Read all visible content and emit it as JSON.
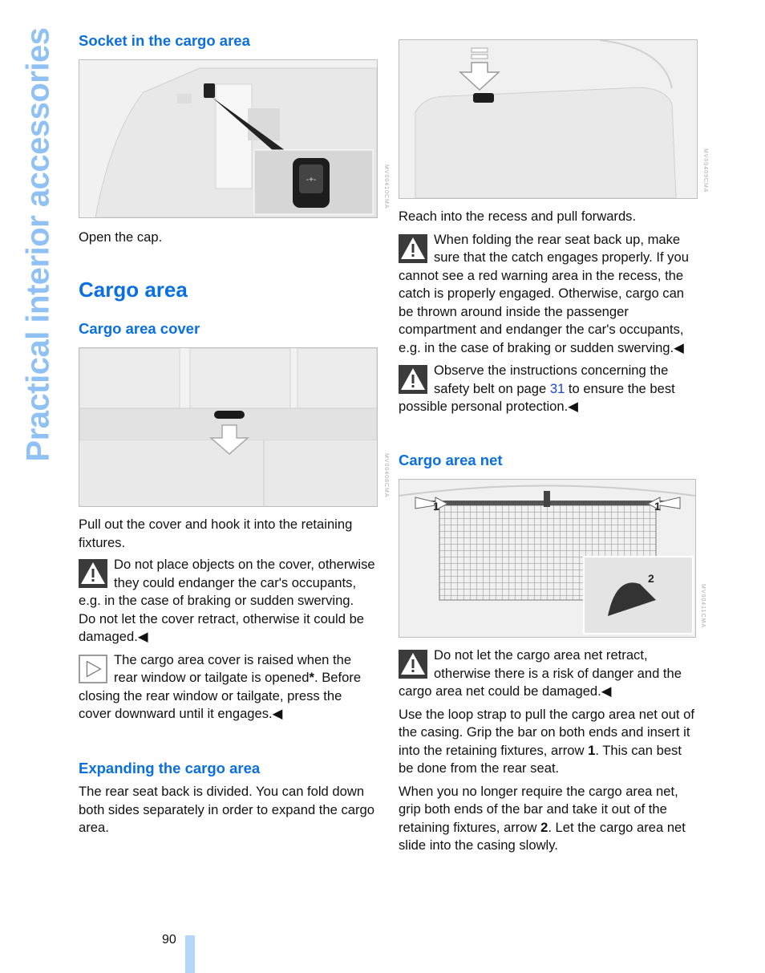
{
  "section_title": "Practical interior accessories",
  "page_number": "90",
  "left": {
    "socket_heading": "Socket in the cargo area",
    "socket_figure_code": "MV00410CMA",
    "socket_text": "Open the cap.",
    "cargo_heading": "Cargo area",
    "cover_heading": "Cargo area cover",
    "cover_figure_code": "MV00408CMA",
    "cover_text": "Pull out the cover and hook it into the retaining fixtures.",
    "warning1_text": "Do not place objects on the cover, otherwise they could endanger the car's occupants, e.g. in the case of braking or sudden swerving.",
    "warning1_text2": "Do not let the cover retract, otherwise it could be damaged.",
    "end_mark": "◀",
    "hint_text_a": "The cargo area cover is raised when the rear window or tailgate is opened",
    "hint_asterisk": "*",
    "hint_text_b": ". Before closing the rear window or tailgate, press the cover downward until it engages.",
    "expand_heading": "Expanding the cargo area",
    "expand_text": "The rear seat back is divided. You can fold down both sides separately in order to expand the cargo area."
  },
  "right": {
    "seat_figure_code": "MV00409CMA",
    "seat_text": "Reach into the recess and pull forwards.",
    "warning2_text": "When folding the rear seat back up, make sure that the catch engages properly. If you cannot see a red warning area in the recess, the catch is properly engaged. Otherwise, cargo can be thrown around inside the passenger compartment and endanger the car's occupants, e.g. in the case of braking or sudden swerving.",
    "warning3_text_a": "Observe the instructions concerning the safety belt on page ",
    "warning3_link": "31",
    "warning3_text_b": " to ensure the best possible personal protection.",
    "net_heading": "Cargo area net",
    "net_figure_code": "MV00411CMA",
    "net_label_1": "1",
    "net_label_2": "2",
    "warning4_text": "Do not let the cargo area net retract, otherwise there is a risk of danger and the cargo area net could be damaged.",
    "net_text1_a": "Use the loop strap to pull the cargo area net out of the casing. Grip the bar on both ends and insert it into the retaining fixtures, arrow ",
    "net_text1_bold": "1",
    "net_text1_b": ". This can best be done from the rear seat.",
    "net_text2_a": "When you no longer require the cargo area net, grip both ends of the bar and take it out of the retaining fixtures, arrow ",
    "net_text2_bold": "2",
    "net_text2_b": ". Let the cargo area net slide into the casing slowly."
  }
}
